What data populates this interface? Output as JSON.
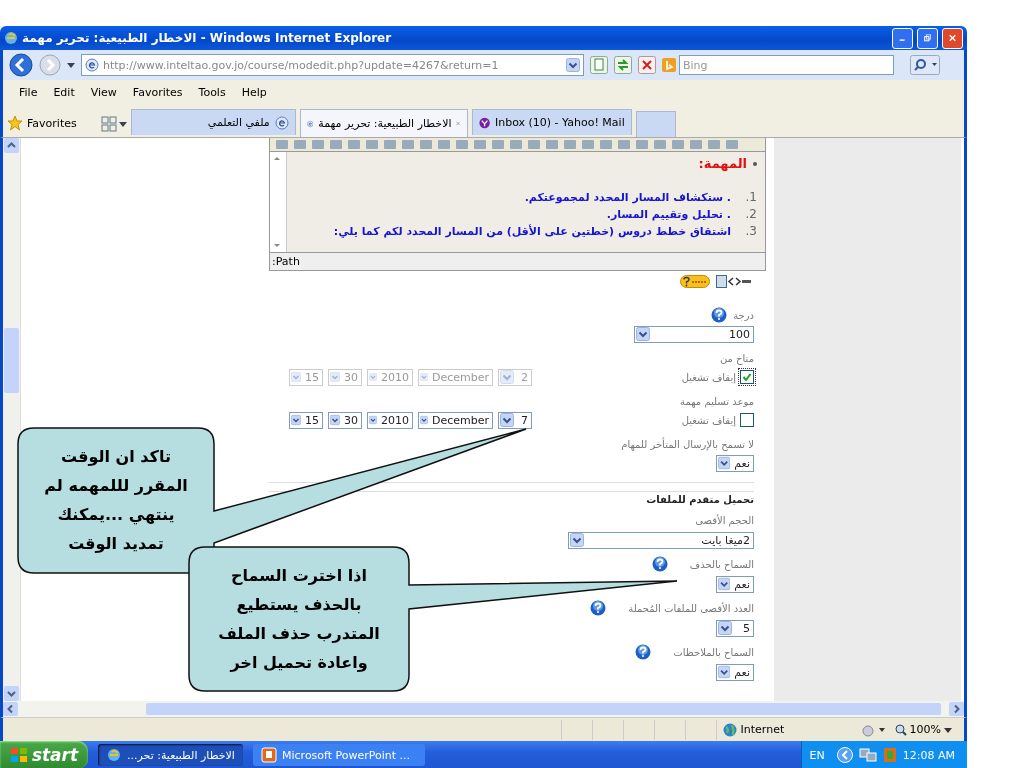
{
  "window": {
    "title": "الاخطار الطبيعية: تحرير مهمة - Windows Internet Explorer"
  },
  "address_bar": {
    "url_host": "http://www.inteltao.gov.jo",
    "url_path": "/course/modedit.php?update=4267&return=1",
    "search_placeholder": "Bing"
  },
  "menu": [
    "Help",
    "Tools",
    "Favorites",
    "View",
    "Edit",
    "File"
  ],
  "favorites_label": "Favorites",
  "tabs": [
    {
      "label": "Inbox (10) - Yahoo! Mail",
      "selected": false
    },
    {
      "label": "الاخطار الطبيعية: تحرير مهمة",
      "selected": true
    },
    {
      "label": "ملفي التعلمي",
      "selected": false
    }
  ],
  "editor": {
    "heading": "المهمة:",
    "items": [
      {
        "number": "1.",
        "text": ". ستكشاف المسار المحدد لمجموعتكم."
      },
      {
        "number": "2.",
        "text": ". تحليل وتقييم المسار."
      },
      {
        "number": "3.",
        "text": "اشتقاق خطط دروس (خطتين على الأقل) من المسار المحدد لكم كما يلي:"
      }
    ],
    "path_label": ":Path"
  },
  "form": {
    "grade": {
      "label": "درجة",
      "value": "100"
    },
    "dates": [
      {
        "label": "متاح من",
        "parts": [
          "2",
          "December",
          "2010",
          "30",
          "15"
        ],
        "disable_label": "إيقاف تشغيل",
        "checked": true
      },
      {
        "label": "موعد تسليم مهمة",
        "parts": [
          "7",
          "December",
          "2010",
          "30",
          "15"
        ],
        "disable_label": "إيقاف تشغيل",
        "checked": false
      }
    ],
    "late": {
      "label": "لا تسمح بالإرسال المتأخر للمهام",
      "value": "نعم"
    },
    "upload": {
      "legend": "تحميل متقدم للملفات",
      "fields": [
        {
          "label": "الحجم الأقصى",
          "value": "2ميغا بايت",
          "kind": "wide",
          "help": false
        },
        {
          "label": "السماح بالحذف",
          "value": "نعم",
          "kind": "small",
          "help": true
        },
        {
          "label": "العدد الأقصى للملفات المُحملة",
          "value": "5",
          "kind": "small",
          "help": true
        },
        {
          "label": "السماح بالملاحظات",
          "value": "نعم",
          "kind": "small",
          "help": true
        }
      ]
    }
  },
  "callouts": [
    {
      "text": "تاكد ان الوقت المقرر لللمهمه لم ينتهي ...يمكنك تمديد الوقت"
    },
    {
      "text": "اذا اخترت السماح بالحذف يستطيع المتدرب حذف الملف واعادة تحميل اخر"
    }
  ],
  "status_bar": {
    "zone": "Internet",
    "zoom": "100%"
  },
  "taskbar": {
    "start": "start",
    "items": [
      {
        "label": "Microsoft PowerPoint ...",
        "selected": false
      },
      {
        "label": "...الاخطار الطبيعية: تحر",
        "selected": true
      }
    ],
    "language": "EN",
    "clock": "12:08 AM"
  }
}
